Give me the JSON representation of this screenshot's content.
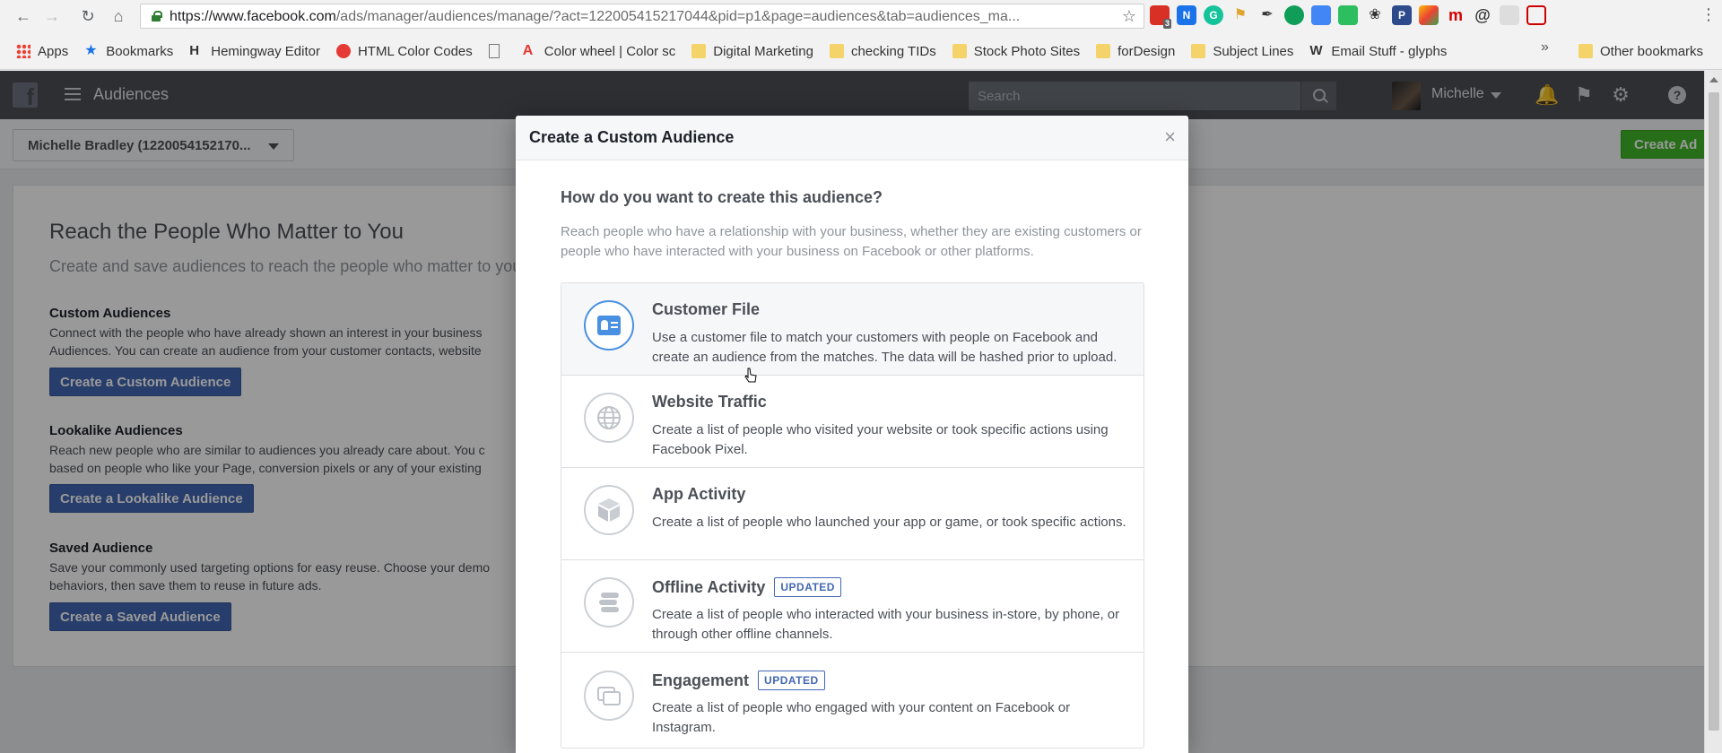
{
  "browser": {
    "url_host": "https://www.facebook.com",
    "url_path": "/ads/manager/audiences/manage/?act=122005415217044&pid=p1&page=audiences&tab=audiences_ma...",
    "ext_badge": "3",
    "bookmarks": [
      {
        "label": "Apps",
        "icon": "apps-grid-icon"
      },
      {
        "label": "Bookmarks",
        "icon": "star-icon"
      },
      {
        "label": "Hemingway Editor",
        "icon": "hemingway-icon"
      },
      {
        "label": "HTML Color Codes",
        "icon": "color-codes-icon"
      },
      {
        "label": "",
        "icon": "page-icon"
      },
      {
        "label": "Color wheel | Color sc",
        "icon": "adobe-icon"
      },
      {
        "label": "Digital Marketing",
        "icon": "folder-icon"
      },
      {
        "label": "checking TIDs",
        "icon": "folder-icon"
      },
      {
        "label": "Stock Photo Sites",
        "icon": "folder-icon"
      },
      {
        "label": "forDesign",
        "icon": "folder-icon"
      },
      {
        "label": "Subject Lines",
        "icon": "folder-icon"
      },
      {
        "label": "Email Stuff - glyphs",
        "icon": "w-icon"
      }
    ],
    "more": "»",
    "other_bookmarks": "Other bookmarks"
  },
  "fb_header": {
    "section_title": "Audiences",
    "search_placeholder": "Search",
    "user_name": "Michelle"
  },
  "subheader": {
    "account": "Michelle Bradley (1220054152170...",
    "create_ad": "Create Ad"
  },
  "main": {
    "title": "Reach the People Who Matter to You",
    "subtitle": "Create and save audiences to reach the people who matter to your",
    "sections": [
      {
        "heading": "Custom Audiences",
        "lines": [
          "Connect with the people who have already shown an interest in your business",
          "Audiences. You can create an audience from your customer contacts, website"
        ],
        "button": "Create a Custom Audience"
      },
      {
        "heading": "Lookalike Audiences",
        "lines": [
          "Reach new people who are similar to audiences you already care about. You c",
          "based on people who like your Page, conversion pixels or any of your existing"
        ],
        "button": "Create a Lookalike Audience"
      },
      {
        "heading": "Saved Audience",
        "lines": [
          "Save your commonly used targeting options for easy reuse. Choose your demo",
          "behaviors, then save them to reuse in future ads."
        ],
        "button": "Create a Saved Audience"
      }
    ]
  },
  "modal": {
    "title": "Create a Custom Audience",
    "close": "×",
    "question": "How do you want to create this audience?",
    "description": "Reach people who have a relationship with your business, whether they are existing customers or people who have interacted with your business on Facebook or other platforms.",
    "options": [
      {
        "title": "Customer File",
        "badge": "",
        "icon": "customer-card-icon",
        "description": "Use a customer file to match your customers with people on Facebook and create an audience from the matches. The data will be hashed prior to upload."
      },
      {
        "title": "Website Traffic",
        "badge": "",
        "icon": "globe-icon",
        "description": "Create a list of people who visited your website or took specific actions using Facebook Pixel."
      },
      {
        "title": "App Activity",
        "badge": "",
        "icon": "cube-icon",
        "description": "Create a list of people who launched your app or game, or took specific actions."
      },
      {
        "title": "Offline Activity",
        "badge": "UPDATED",
        "icon": "offline-stack-icon",
        "description": "Create a list of people who interacted with your business in-store, by phone, or through other offline channels."
      },
      {
        "title": "Engagement",
        "badge": "UPDATED",
        "icon": "engagement-icon",
        "description": "Create a list of people who engaged with your content on Facebook or Instagram."
      }
    ]
  },
  "colors": {
    "fb_blue": "#4267b2",
    "fb_green": "#42b72a",
    "header_gray": "#4b4f56",
    "highlight_blue": "#4a90e2"
  }
}
